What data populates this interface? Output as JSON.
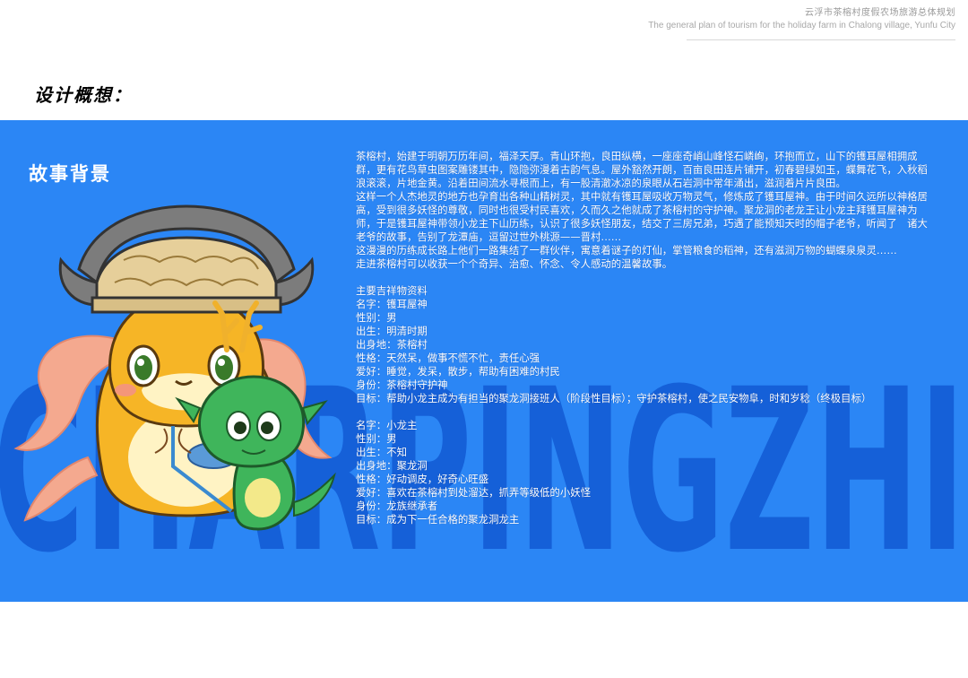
{
  "header": {
    "cn": "云浮市茶榕村度假农场旅游总体规划",
    "en": "The general plan of tourism for the holiday farm in Chalong village, Yunfu City"
  },
  "section_title": "设计概想：",
  "story": {
    "title": "故事背景",
    "background_word": "CHARPINGZHI",
    "paragraphs": [
      "茶榕村，始建于明朝万历年间，福泽天厚。青山环抱，良田纵横，一座座奇峭山峰怪石嶙峋，环抱而立，山下的镬耳屋相拥成群，更有花鸟草虫图案雕镂其中，隐隐弥漫着古韵气息。屋外豁然开朗，百亩良田连片铺开，初春碧绿如玉，蝶舞花飞，入秋稻浪滚滚，片地金黄。沿着田间流水寻根而上，有一股清澈冰凉的泉眼从石岩洞中常年涌出，滋润着片片良田。",
      "这样一个人杰地灵的地方也孕育出各种山精树灵，其中就有镬耳屋吸收万物灵气，修炼成了镬耳屋神。由于时间久远所以神格居高，受到很多妖怪的尊敬，同时也很受村民喜欢，久而久之他就成了茶榕村的守护神。聚龙洞的老龙王让小龙主拜镬耳屋神为师，于是镬耳屋神带领小龙主下山历练，认识了很多妖怪朋友，结交了三房兄弟，巧遇了能预知天时的帽子老爷，听闻了　诸大老爷的故事，告别了龙潭庙，逗留过世外桃源——晋村……",
      "这漫漫的历练成长路上他们一路集结了一群伙伴，寓意着谜子的灯仙，掌管粮食的稻神，还有滋润万物的蝴蝶泉泉灵……",
      "走进茶榕村可以收获一个个奇异、治愈、怀念、令人感动的温馨故事。"
    ],
    "mascot_heading": "主要吉祥物资料",
    "mascot1": [
      "名字：镬耳屋神",
      "性别：男",
      "出生：明清时期",
      "出身地：茶榕村",
      "性格：天然呆，做事不慌不忙，责任心强",
      "爱好：睡觉，发呆，散步，帮助有困难的村民",
      "身份：茶榕村守护神",
      "目标：帮助小龙主成为有担当的聚龙洞接班人（阶段性目标）；守护茶榕村，使之民安物阜，时和岁稔（终极目标）"
    ],
    "mascot2": [
      "名字：小龙主",
      "性别：男",
      "出生：不知",
      "出身地：聚龙洞",
      "性格：好动调皮，好奇心旺盛",
      "爱好：喜欢在茶榕村到处溜达，抓弄等级低的小妖怪",
      "身份：龙族继承者",
      "目标：成为下一任合格的聚龙洞龙主"
    ]
  },
  "colors": {
    "panel_bg": "#2b86f5",
    "bg_letters": "#1560d8",
    "mascot_body": "#f6b526",
    "dragon_body": "#3fb55b"
  }
}
